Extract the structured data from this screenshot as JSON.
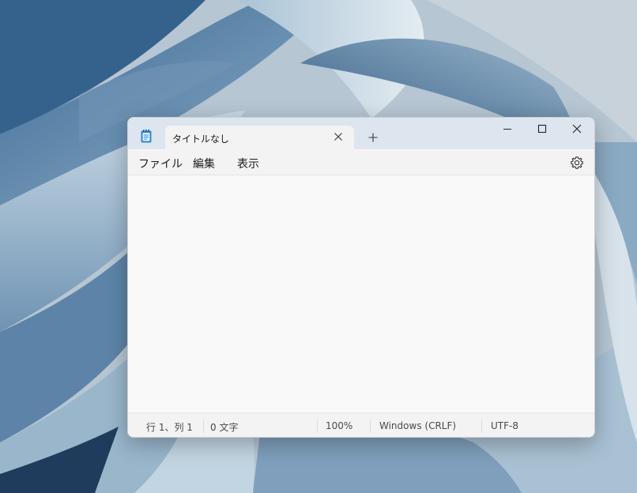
{
  "window": {
    "tab_title": "タイトルなし",
    "icons": {
      "app": "notepad-icon",
      "tab_close": "close-icon",
      "new_tab": "plus-icon",
      "minimize": "minimize-icon",
      "maximize": "maximize-icon",
      "close": "close-icon",
      "settings": "gear-icon"
    }
  },
  "menu": {
    "file": "ファイル",
    "edit": "編集",
    "view": "表示"
  },
  "editor": {
    "content": ""
  },
  "status": {
    "position": "行 1、列 1",
    "char_count": "0 文字",
    "zoom": "100%",
    "line_ending": "Windows (CRLF)",
    "encoding": "UTF-8"
  },
  "colors": {
    "titlebar": "#dde5ee",
    "tab": "#f3f3f3",
    "editor_bg": "#f9f9f9",
    "accent_icon": "#2b88d8"
  }
}
